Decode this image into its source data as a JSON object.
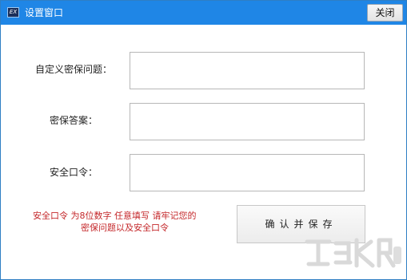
{
  "window": {
    "title": "设置窗口",
    "close_label": "关闭",
    "icon": "ex-app-icon"
  },
  "form": {
    "question_label": "自定义密保问题：",
    "question_value": "",
    "answer_label": "密保答案：",
    "answer_value": "",
    "password_label": "安全口令：",
    "password_value": ""
  },
  "hint": {
    "line1": "安全口令  为8位数字  任意填写  请牢记您的",
    "line2": "密保问题以及安全口令"
  },
  "confirm_label": "确认并保存",
  "colors": {
    "titlebar": "#1f86e6",
    "hint_text": "#c4272a"
  }
}
